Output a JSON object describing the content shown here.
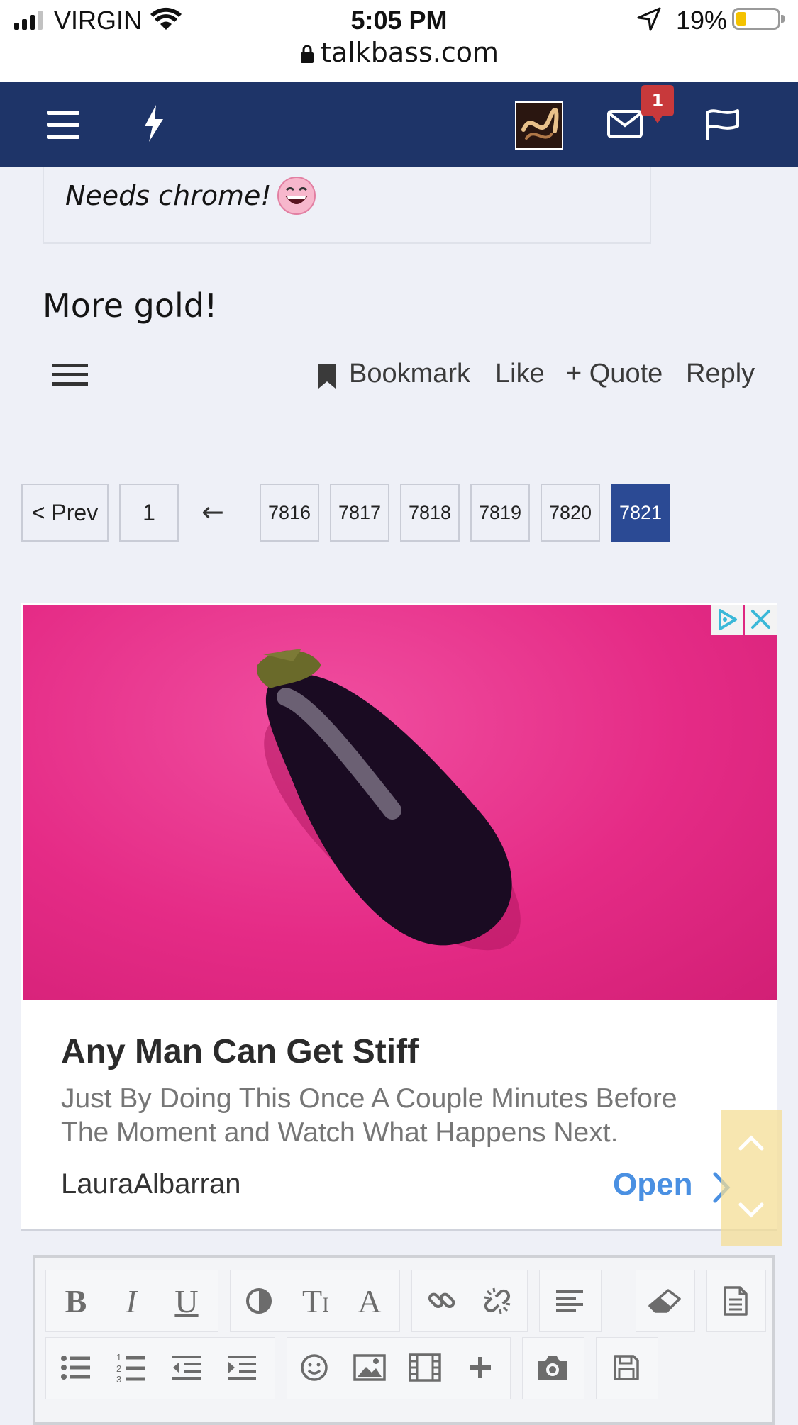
{
  "status_bar": {
    "carrier": "VIRGIN",
    "time": "5:05 PM",
    "battery": "19%",
    "battery_level": 0.19,
    "url": "talkbass.com"
  },
  "nav": {
    "notification_count": "1"
  },
  "post": {
    "quote_text": "Needs chrome!",
    "text": "More gold!",
    "actions": {
      "bookmark": "Bookmark",
      "like": "Like",
      "quote": "+ Quote",
      "reply": "Reply"
    }
  },
  "pagination": {
    "prev": "< Prev",
    "first": "1",
    "gap": "←",
    "pages": [
      "7816",
      "7817",
      "7818",
      "7819",
      "7820",
      "7821"
    ],
    "current": "7821"
  },
  "ad": {
    "headline": "Any Man Can Get Stiff",
    "body": "Just By Doing This Once A Couple Minutes Before The Moment and Watch What Happens Next.",
    "source": "LauraAlbarran",
    "cta": "Open"
  },
  "colors": {
    "nav_bg": "#1e3468",
    "current_page_bg": "#2b4a94",
    "badge": "#c8393b",
    "ad_bg": "#e52b86",
    "cta": "#4a90e2"
  },
  "editor_toolbar": {
    "row1": [
      "bold",
      "italic",
      "underline",
      "color",
      "font-size",
      "font-family",
      "link",
      "unlink",
      "align",
      "remove-format",
      "source"
    ],
    "row2": [
      "bulleted-list",
      "numbered-list",
      "outdent",
      "indent",
      "smilies",
      "image",
      "media",
      "insert",
      "camera",
      "save-draft"
    ],
    "bold_label": "B",
    "italic_label": "I",
    "underline_label": "U",
    "font_size_label": "T",
    "font_label": "A"
  }
}
